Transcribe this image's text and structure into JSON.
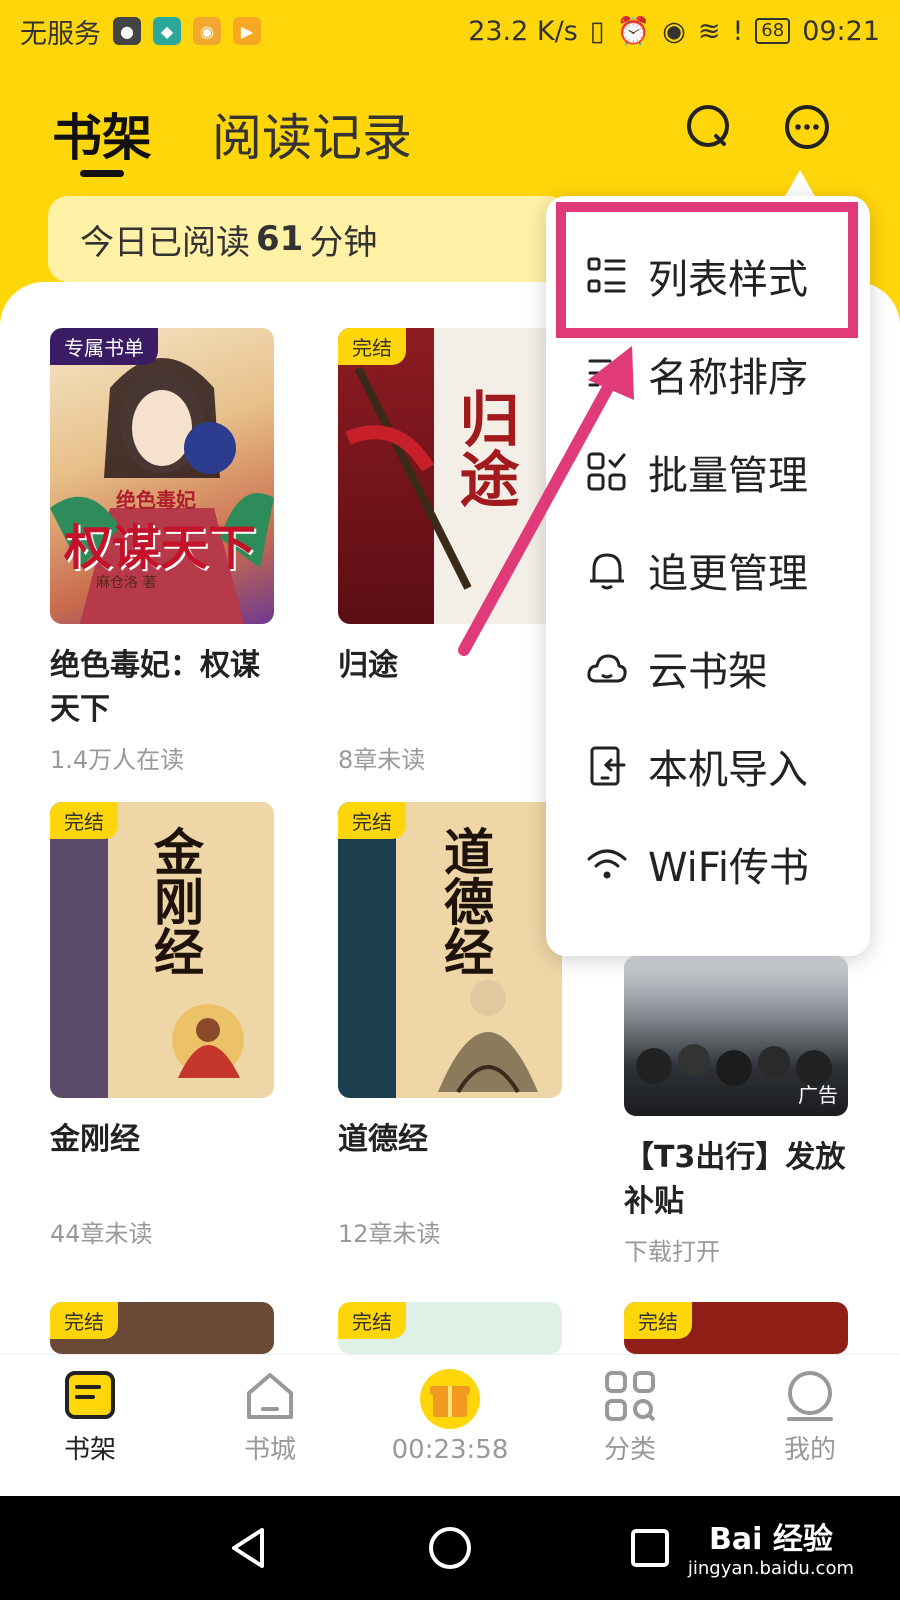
{
  "status_bar": {
    "carrier": "无服务",
    "speed": "23.2 K/s",
    "battery": "68",
    "time": "09:21",
    "app_icons": [
      "game-icon",
      "shield-icon",
      "weibo-icon",
      "play-icon"
    ],
    "indicator_icons": [
      "vibrate-icon",
      "alarm-icon",
      "eye-icon",
      "wifi-icon",
      "sim-alert-icon"
    ]
  },
  "header": {
    "tabs": [
      {
        "label": "书架",
        "active": true
      },
      {
        "label": "阅读记录",
        "active": false
      }
    ],
    "icons": [
      "search-icon",
      "more-icon"
    ]
  },
  "reading_banner": {
    "prefix": "今日已阅读",
    "minutes": "61",
    "suffix": "分钟"
  },
  "books": [
    {
      "title": "绝色毒妃：权谋天下",
      "subtitle": "1.4万人在读",
      "badge": "专属书单",
      "cover_text": "权谋天下",
      "cover_top": "绝色毒妃",
      "cover_author": "麻仓洛 著"
    },
    {
      "title": "归途",
      "subtitle": "8章未读",
      "badge": "完结",
      "cover_text": "归途"
    },
    {
      "title": "金刚经",
      "subtitle": "44章未读",
      "badge": "完结",
      "cover_text": "金刚经"
    },
    {
      "title": "道德经",
      "subtitle": "12章未读",
      "badge": "完结",
      "cover_text": "道德经"
    },
    {
      "title": "【T3出行】发放补贴",
      "subtitle": "下载打开",
      "ad_label": "广告"
    }
  ],
  "row3_badges": [
    "完结",
    "完结",
    "完结"
  ],
  "dropdown": {
    "items": [
      {
        "label": "列表样式",
        "icon": "list-style-icon",
        "highlighted": true
      },
      {
        "label": "名称排序",
        "icon": "sort-icon"
      },
      {
        "label": "批量管理",
        "icon": "batch-manage-icon"
      },
      {
        "label": "追更管理",
        "icon": "bell-icon"
      },
      {
        "label": "云书架",
        "icon": "cloud-icon"
      },
      {
        "label": "本机导入",
        "icon": "import-icon"
      },
      {
        "label": "WiFi传书",
        "icon": "wifi-icon"
      }
    ]
  },
  "bottom_nav": {
    "items": [
      {
        "label": "书架",
        "icon": "bookshelf-icon",
        "active": true
      },
      {
        "label": "书城",
        "icon": "home-icon"
      },
      {
        "label": "00:23:58",
        "icon": "gift-icon"
      },
      {
        "label": "分类",
        "icon": "category-icon"
      },
      {
        "label": "我的",
        "icon": "profile-icon"
      }
    ]
  },
  "watermark": {
    "brand": "Bai 经验",
    "url": "jingyan.baidu.com"
  },
  "colors": {
    "brand_yellow": "#FFD60A",
    "annotation_pink": "#E03A79"
  }
}
